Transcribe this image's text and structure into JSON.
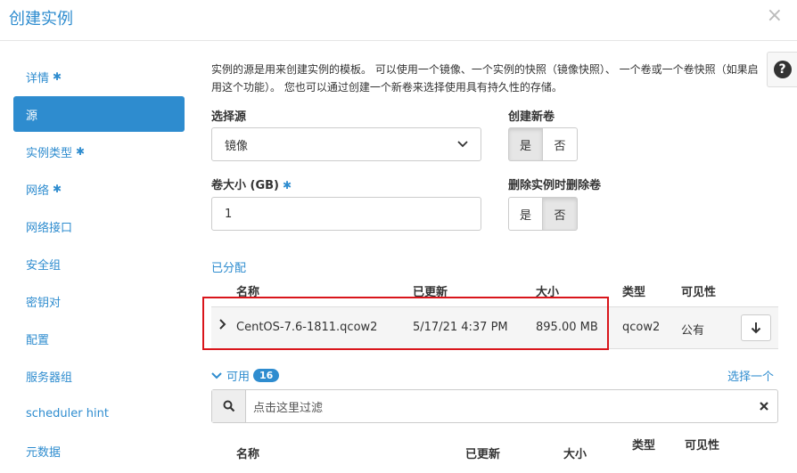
{
  "modal": {
    "title": "创建实例",
    "close": "×"
  },
  "sidebar": {
    "items": [
      {
        "label": "详情",
        "required": true,
        "active": false
      },
      {
        "label": "源",
        "required": false,
        "active": true
      },
      {
        "label": "实例类型",
        "required": true,
        "active": false
      },
      {
        "label": "网络",
        "required": true,
        "active": false
      },
      {
        "label": "网络接口",
        "required": false,
        "active": false
      },
      {
        "label": "安全组",
        "required": false,
        "active": false
      },
      {
        "label": "密钥对",
        "required": false,
        "active": false
      },
      {
        "label": "配置",
        "required": false,
        "active": false
      },
      {
        "label": "服务器组",
        "required": false,
        "active": false
      },
      {
        "label": "scheduler hint",
        "required": false,
        "active": false
      },
      {
        "label": "元数据",
        "required": false,
        "active": false
      }
    ],
    "required_mark": "✱"
  },
  "help": {
    "icon": "?"
  },
  "description": "实例的源是用来创建实例的模板。 可以使用一个镜像、一个实例的快照（镜像快照）、 一个卷或一个卷快照（如果启用这个功能）。 您也可以通过创建一个新卷来选择使用具有持久性的存储。",
  "form": {
    "select_source_label": "选择源",
    "select_source_value": "镜像",
    "create_volume_label": "创建新卷",
    "create_volume_yes": "是",
    "create_volume_no": "否",
    "create_volume_selected": "yes",
    "volume_size_label": "卷大小 (GB)",
    "volume_size_value": "1",
    "delete_volume_label": "删除实例时删除卷",
    "delete_volume_yes": "是",
    "delete_volume_no": "否",
    "delete_volume_selected": "no"
  },
  "allocated": {
    "title": "已分配",
    "headers": {
      "name": "名称",
      "updated": "已更新",
      "size": "大小",
      "type": "类型",
      "visibility": "可见性"
    },
    "rows": [
      {
        "name": "CentOS-7.6-1811.qcow2",
        "updated": "5/17/21 4:37 PM",
        "size": "895.00 MB",
        "type": "qcow2",
        "visibility": "公有"
      }
    ]
  },
  "available": {
    "title": "可用",
    "count": "16",
    "select_one": "选择一个",
    "filter_placeholder": "点击这里过滤",
    "headers": {
      "name": "名称",
      "updated": "已更新",
      "size": "大小",
      "type": "类型",
      "visibility": "可见性"
    }
  }
}
